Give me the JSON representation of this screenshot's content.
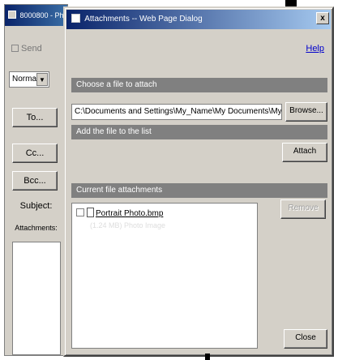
{
  "background_window": {
    "title": "8000800 - Ph",
    "toolbar_text": "Send",
    "select_value": "Normal",
    "buttons": [
      "To...",
      "Cc...",
      "Bcc..."
    ],
    "subject_label": "Subject:",
    "attachments_label": "Attachments:"
  },
  "dialog": {
    "title": "Attachments -- Web Page Dialog",
    "close_glyph": "x",
    "help_link": "Help",
    "section_choose": "Choose a file to attach",
    "path_value": "C:\\Documents and Settings\\My_Name\\My Documents\\My Pictures\\file",
    "browse_label": "Browse...",
    "section_add": "Add the file to the list",
    "attach_label": "Attach",
    "section_current": "Current file attachments",
    "attachment_file": "Portrait Photo.bmp",
    "attachment_sub": "(1.24 MB) Photo Image",
    "remove_label": "Remove",
    "close_label": "Close"
  }
}
